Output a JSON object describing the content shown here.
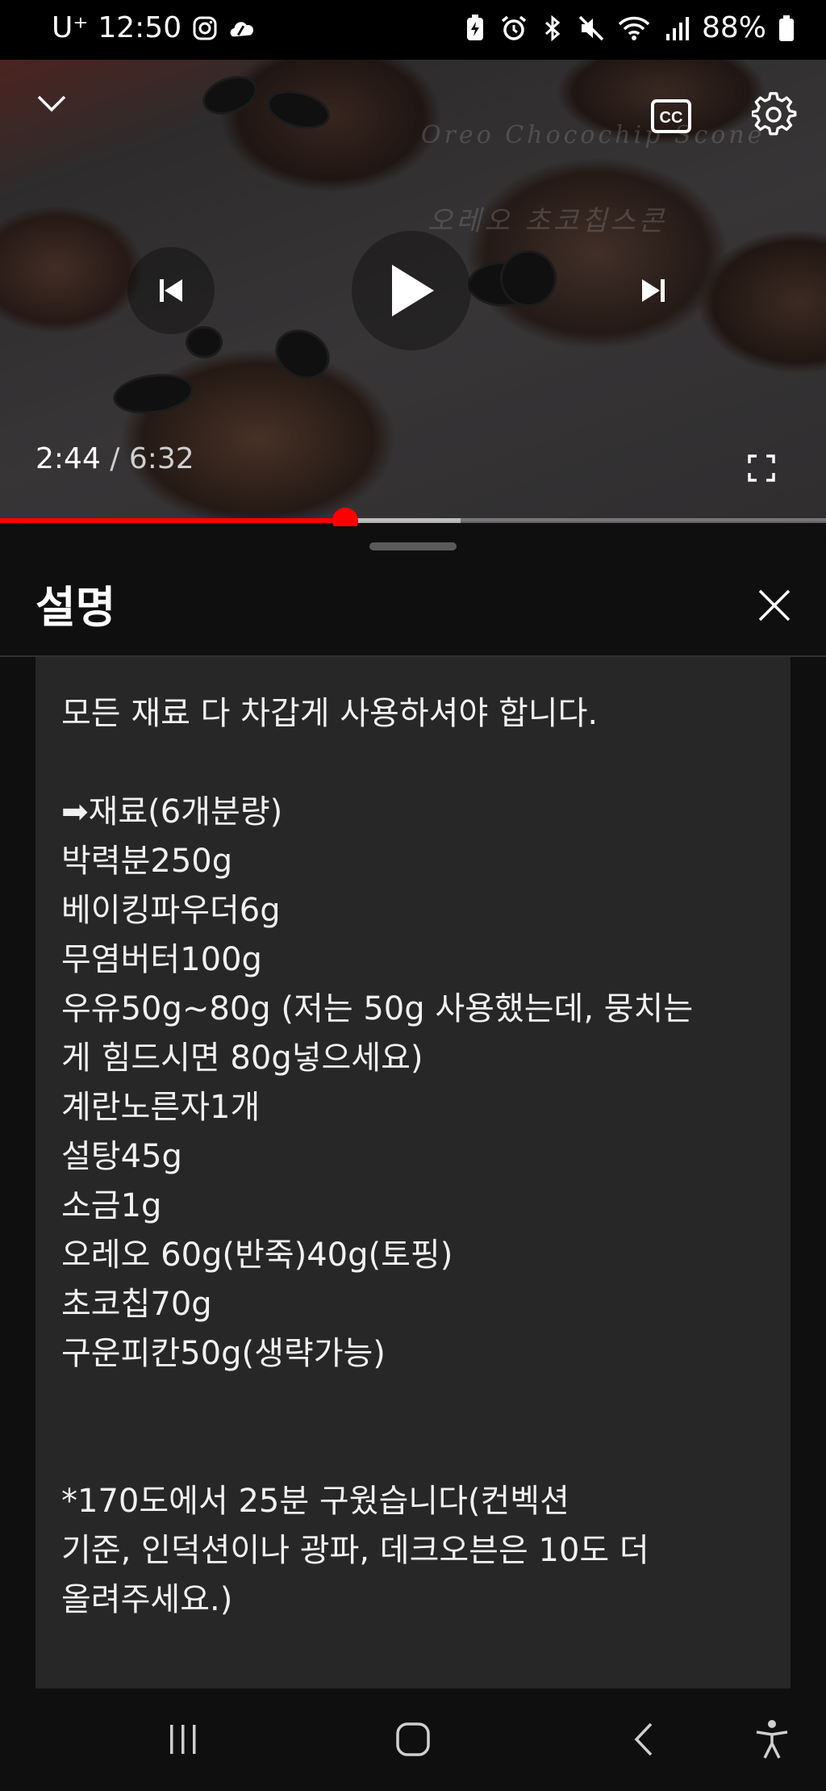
{
  "status_bar": {
    "carrier": "U⁺",
    "time": "12:50",
    "battery": "88%",
    "icons": [
      "instagram-icon",
      "cloud-app-icon",
      "battery-saver-icon",
      "alarm-icon",
      "bluetooth-icon",
      "mute-icon",
      "wifi-icon",
      "signal-icon",
      "battery-icon"
    ]
  },
  "player": {
    "current_time": "2:44",
    "separator": " / ",
    "duration": "6:32",
    "progress": 0.418,
    "buffered": 0.558,
    "watermark_en": "Oreo Chocochip Scone",
    "watermark_ko": "오레오 초코칩스콘",
    "accent_color": "#ff0000"
  },
  "sheet": {
    "title": "설명",
    "description_lines": [
      "모든 재료 다 차갑게 사용하셔야 합니다.",
      "",
      "➡재료(6개분량)",
      "박력분250g",
      "베이킹파우더6g",
      "무염버터100g",
      "우유50g~80g (저는 50g 사용했는데, 뭉치는",
      "게 힘드시면 80g넣으세요)",
      "계란노른자1개",
      "설탕45g",
      "소금1g",
      "오레오 60g(반죽)40g(토핑)",
      "초코칩70g",
      "구운피칸50g(생략가능)",
      "",
      "",
      "*170도에서 25분 구웠습니다(컨벡션",
      "기준, 인덕션이나 광파, 데크오븐은 10도 더",
      "올려주세요.)",
      "",
      "-----------------------------------------"
    ]
  },
  "nav_bar": {
    "buttons": [
      "recent-apps",
      "home",
      "back",
      "accessibility"
    ]
  }
}
